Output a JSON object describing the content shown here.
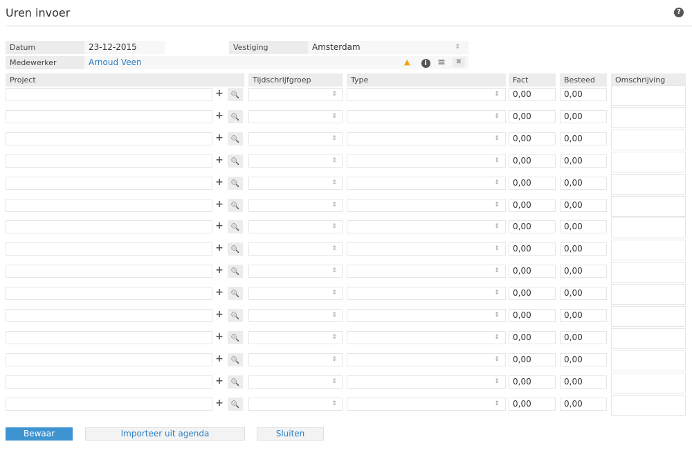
{
  "header": {
    "title": "Uren invoer",
    "help_icon": "?"
  },
  "form": {
    "datum_label": "Datum",
    "datum_value": "23-12-2015",
    "vestiging_label": "Vestiging",
    "vestiging_value": "Amsterdam",
    "medewerker_label": "Medewerker",
    "medewerker_value": "Arnoud Veen"
  },
  "icons": {
    "sort": "⇕",
    "warning": "▲",
    "info": "i",
    "menu": "≡",
    "close": "✖",
    "plus": "+",
    "search": "🔍"
  },
  "table": {
    "columns": [
      "Project",
      "Tijdschrijfgroep",
      "Type",
      "Fact",
      "Besteed",
      "Omschrijving"
    ],
    "rows": [
      {
        "fact": "0,00",
        "besteed": "0,00"
      },
      {
        "fact": "0,00",
        "besteed": "0,00"
      },
      {
        "fact": "0,00",
        "besteed": "0,00"
      },
      {
        "fact": "0,00",
        "besteed": "0,00"
      },
      {
        "fact": "0,00",
        "besteed": "0,00"
      },
      {
        "fact": "0,00",
        "besteed": "0,00"
      },
      {
        "fact": "0,00",
        "besteed": "0,00"
      },
      {
        "fact": "0,00",
        "besteed": "0,00"
      },
      {
        "fact": "0,00",
        "besteed": "0,00"
      },
      {
        "fact": "0,00",
        "besteed": "0,00"
      },
      {
        "fact": "0,00",
        "besteed": "0,00"
      },
      {
        "fact": "0,00",
        "besteed": "0,00"
      },
      {
        "fact": "0,00",
        "besteed": "0,00"
      },
      {
        "fact": "0,00",
        "besteed": "0,00"
      },
      {
        "fact": "0,00",
        "besteed": "0,00"
      }
    ]
  },
  "buttons": {
    "save": "Bewaar",
    "import": "Importeer uit agenda",
    "close": "Sluiten"
  },
  "colors": {
    "primary": "#3e94d1",
    "link": "#2a7fc4",
    "warning": "#f0a30a"
  }
}
